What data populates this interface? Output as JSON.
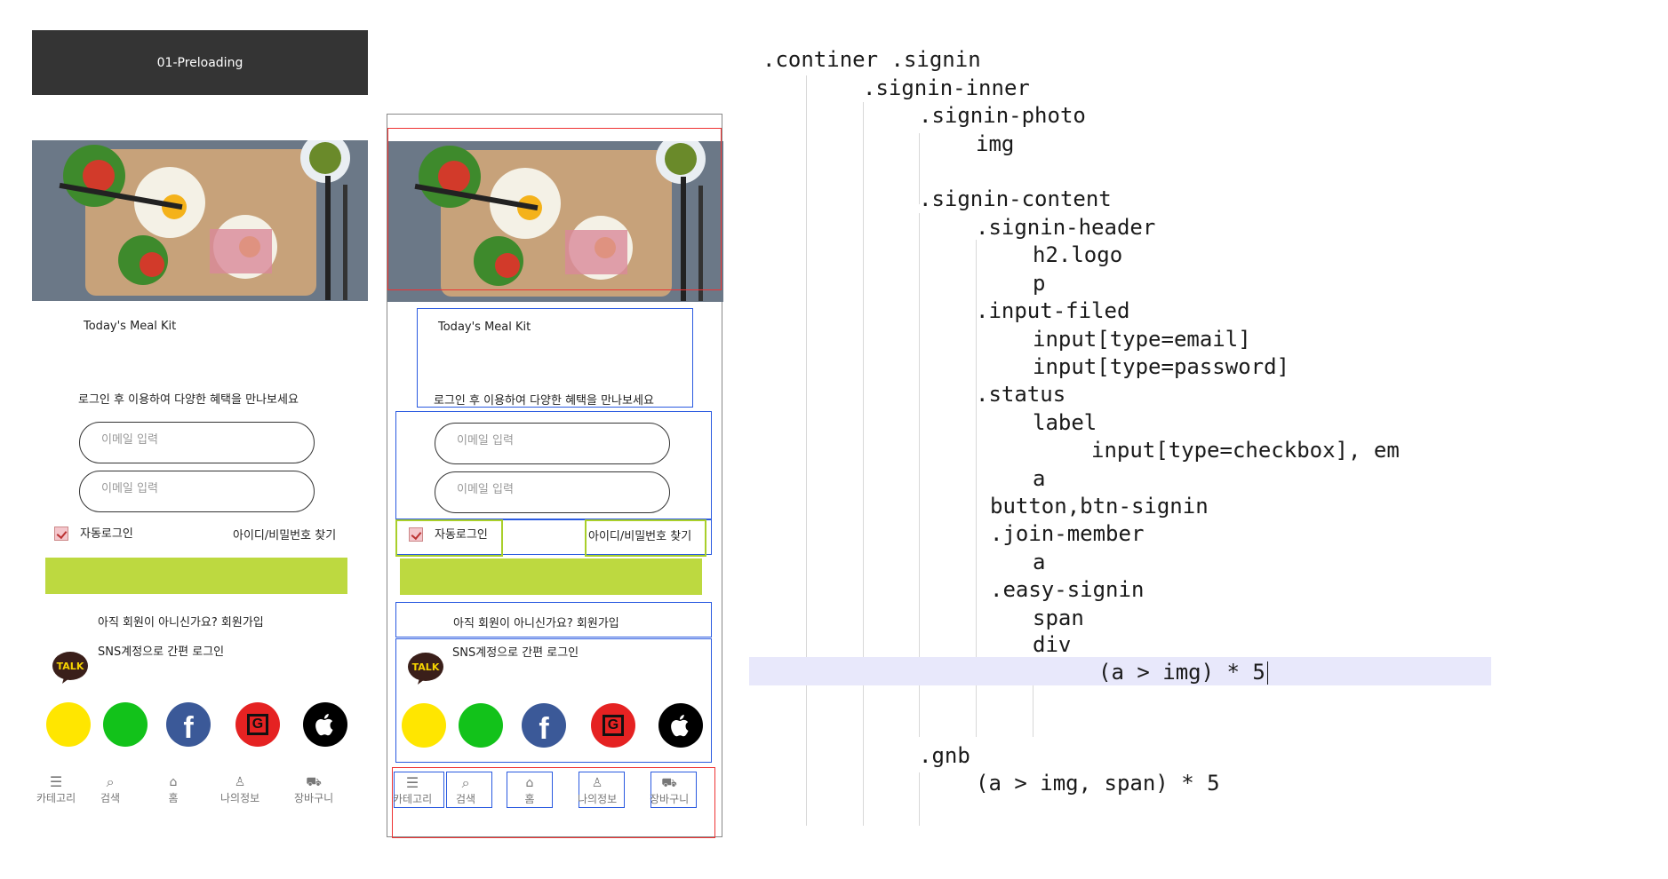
{
  "preload_label": "01-Preloading",
  "mockup": {
    "meal_title": "Today's Meal Kit",
    "subtitle": "로그인 후 이용하여 다양한 혜택을 만나보세요",
    "email_placeholder": "이메일 입력",
    "password_placeholder": "이메일 입력",
    "auto_login": "자동로그인",
    "find_account": "아이디/비밀번호 찾기",
    "join_text": "아직 회원이 아니신가요? 회원가입",
    "sns_title": "SNS계정으로 간편 로그인",
    "talk_label": "TALK",
    "gnb": [
      "카테고리",
      "검색",
      "홈",
      "나의정보",
      "장바구니"
    ],
    "social_colors": [
      "#ffe600",
      "#12c21a",
      "#3b5998",
      "#e52222",
      "#000000"
    ],
    "brand_color": "#bdd940"
  },
  "code_lines": [
    ".continer .signin",
    ".signin-inner",
    ".signin-photo",
    "img",
    ".signin-content",
    ".signin-header",
    "h2.logo",
    "p",
    ".input-filed",
    "input[type=email]",
    "input[type=password]",
    ".status",
    "label",
    "input[type=checkbox], em",
    "a",
    "button,btn-signin",
    ".join-member",
    "a",
    ".easy-signin",
    "span",
    "div",
    "(a > img) * 5",
    ".gnb",
    "(a > img, span) * 5"
  ]
}
